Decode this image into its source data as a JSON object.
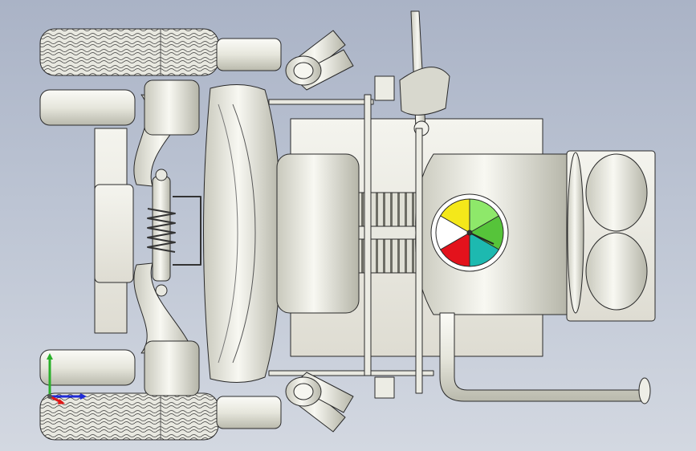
{
  "viewport": {
    "background_top": "#aab3c6",
    "background_bottom": "#d3d8e1"
  },
  "model": {
    "body_color": "#ecece4",
    "edge_color": "#2a2a2a",
    "gauge": {
      "segments": [
        {
          "color": "#f4e81a"
        },
        {
          "color": "#8ee86a"
        },
        {
          "color": "#56c43a"
        },
        {
          "color": "#1db9b0"
        },
        {
          "color": "#e3121c"
        },
        {
          "color": "#ffffff"
        }
      ]
    }
  },
  "triad": {
    "x_color": "#1f2bd8",
    "y_color": "#2ab02a",
    "z_color": "#e01818"
  }
}
